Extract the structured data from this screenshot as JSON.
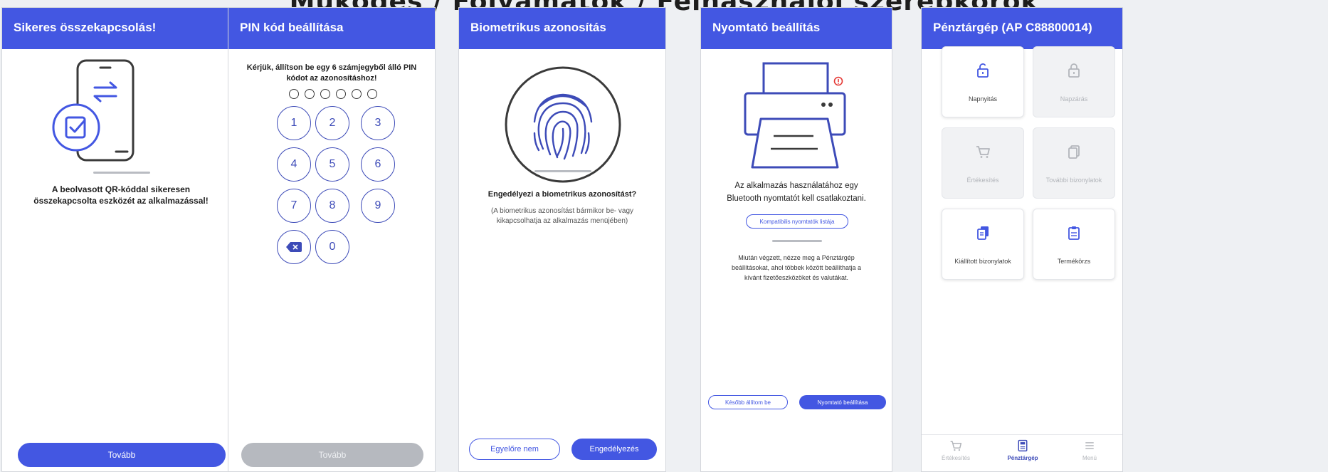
{
  "top_title": "Működés / Folyamatok / Felhasználói szerepkörök",
  "screen1": {
    "header": "Sikeres összekapcsolás!",
    "message_line1": "A beolvasott QR-kóddal sikeresen",
    "message_line2": "összekapcsolta eszközét az alkalmazással!",
    "button": "Tovább"
  },
  "screen2": {
    "header": "PIN kód beállítása",
    "instruction_line1": "Kérjük, állítson be egy 6 számjegyből álló PIN",
    "instruction_line2": "kódot az azonosításhoz!",
    "keys": [
      "1",
      "2",
      "3",
      "4",
      "5",
      "6",
      "7",
      "8",
      "9",
      "0"
    ],
    "button": "Tovább"
  },
  "screen3": {
    "header": "Biometrikus azonosítás",
    "question": "Engedélyezi a biometrikus azonosítást?",
    "note_line1": "(A biometrikus azonosítást bármikor be- vagy",
    "note_line2": "kikapcsolhatja az alkalmazás menüjében)",
    "btn_decline": "Egyelőre nem",
    "btn_allow": "Engedélyezés"
  },
  "screen4": {
    "header": "Nyomtató beállítás",
    "main_line1": "Az alkalmazás használatához egy",
    "main_line2": "Bluetooth nyomtatót kell csatlakoztani.",
    "compat_link": "Kompatibilis nyomtatók listája",
    "info_line1": "Miután végzett, nézze meg a Pénztárgép",
    "info_line2": "beállításokat, ahol többek között beállíthatja a",
    "info_line3": "kívánt fizetőeszközöket és valutákat.",
    "btn_later": "Később állítom be",
    "btn_setup": "Nyomtató beállítása"
  },
  "screen5": {
    "header": "Pénztárgép (AP C88800014)",
    "tiles": [
      {
        "label": "Napnyitás",
        "icon": "unlock-icon",
        "enabled": true
      },
      {
        "label": "Napzárás",
        "icon": "lock-icon",
        "enabled": false
      },
      {
        "label": "Értékesítés",
        "icon": "cart-icon",
        "enabled": false
      },
      {
        "label": "További bizonylatok",
        "icon": "documents-icon",
        "enabled": false
      },
      {
        "label": "Kiállított bizonylatok",
        "icon": "receipts-icon",
        "enabled": true
      },
      {
        "label": "Termékörzs",
        "icon": "clipboard-icon",
        "enabled": true
      }
    ],
    "nav": [
      {
        "label": "Értékesítés",
        "icon": "cart-icon",
        "active": false
      },
      {
        "label": "Pénztárgép",
        "icon": "register-icon",
        "active": true
      },
      {
        "label": "Menü",
        "icon": "menu-icon",
        "active": false
      }
    ]
  },
  "colors": {
    "primary": "#4357e2",
    "icon_blue": "#3d4bb8",
    "disabled": "#b6b9bf",
    "alert": "#e53935"
  }
}
